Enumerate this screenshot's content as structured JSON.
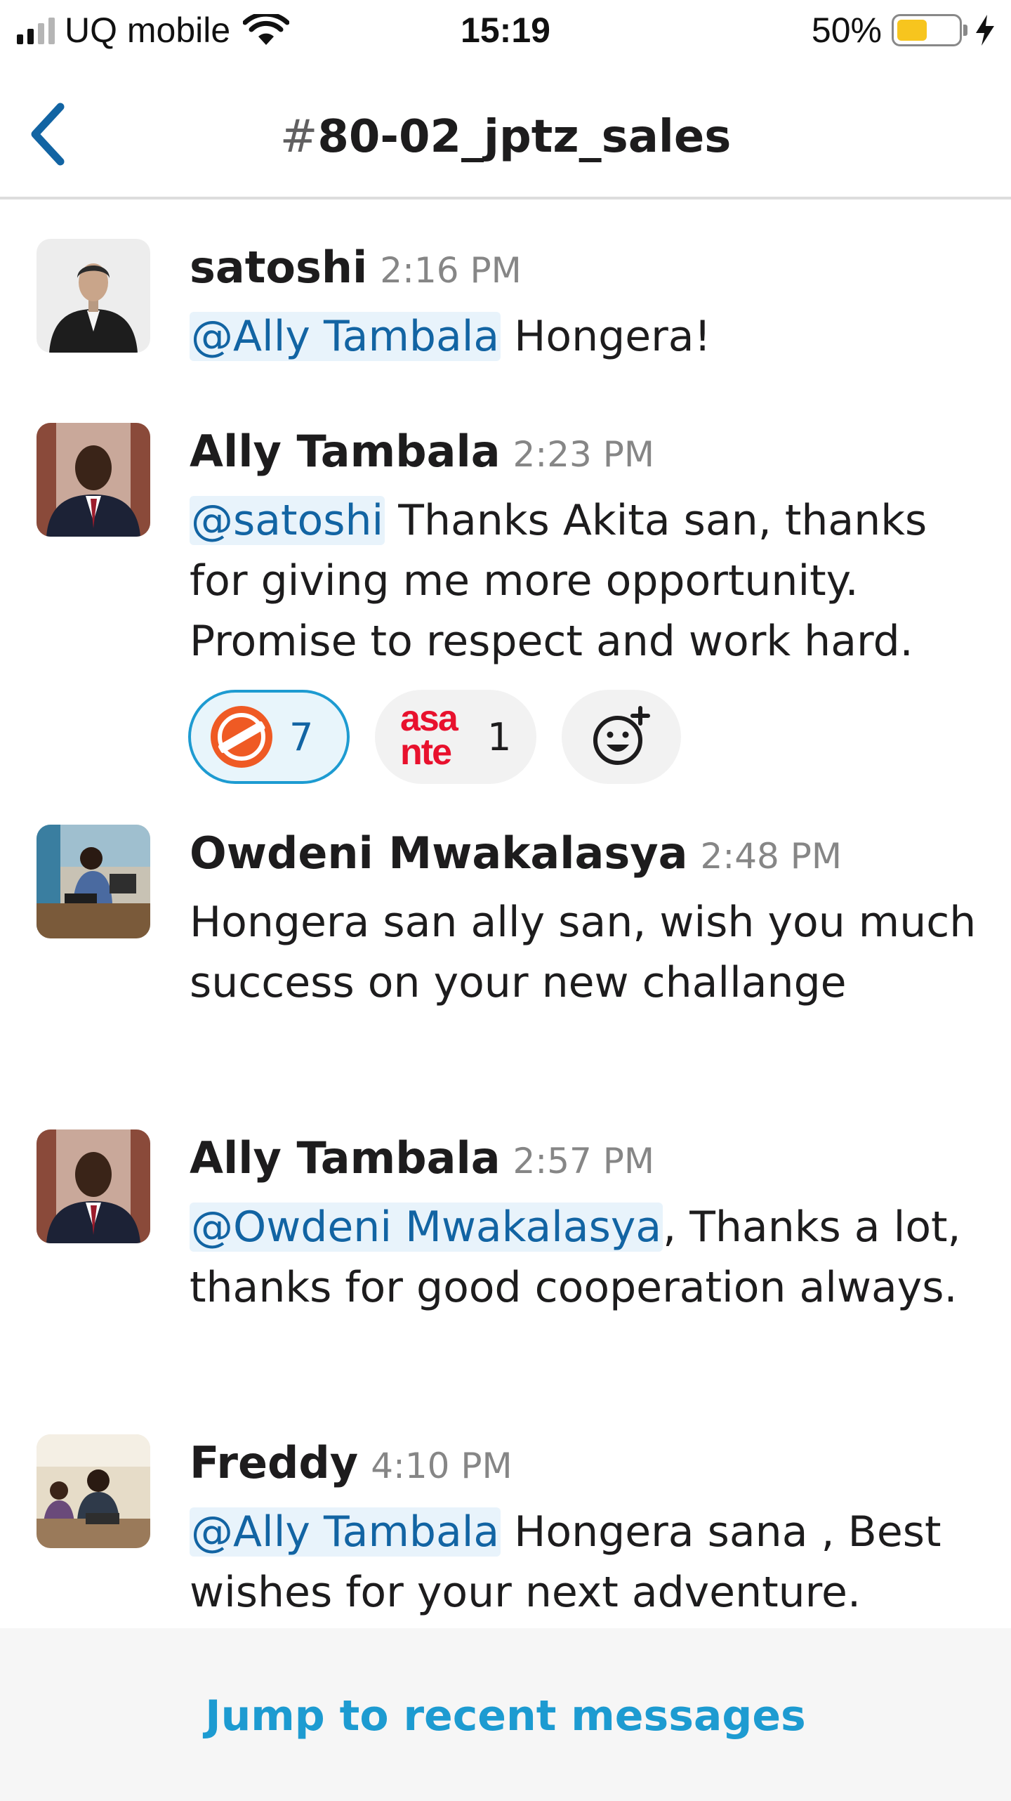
{
  "status_bar": {
    "carrier": "UQ mobile",
    "time": "15:19",
    "battery_percent": "50%",
    "battery_level": 0.5,
    "battery_color": "#f7c51e",
    "signal_bars": 2,
    "icons": [
      "signal-icon",
      "wifi-icon",
      "battery-icon",
      "charging-bolt-icon"
    ]
  },
  "header": {
    "hash": "#",
    "channel_name": "80-02_jptz_sales",
    "back_icon": "chevron-left-icon"
  },
  "messages": [
    {
      "author": "satoshi",
      "time": "2:16 PM",
      "mention": "@Ally Tambala",
      "text": " Hongera!"
    },
    {
      "author": "Ally Tambala",
      "time": "2:23 PM",
      "mention": "@satoshi",
      "text": " Thanks Akita san, thanks for giving me more opportunity. Promise to respect and work hard.",
      "reactions": [
        {
          "icon": "custom-emoji-icon",
          "count": "7",
          "selected": true
        },
        {
          "icon": "asante-emoji-icon",
          "label_top": "asa",
          "label_bottom": "nte",
          "count": "1",
          "selected": false
        },
        {
          "icon": "add-reaction-icon"
        }
      ]
    },
    {
      "author": "Owdeni Mwakalasya",
      "time": "2:48 PM",
      "text": "Hongera san ally san, wish you much success on your new challange"
    },
    {
      "author": "Ally Tambala",
      "time": "2:57 PM",
      "mention": "@Owdeni Mwakalasya",
      "text": ", Thanks a lot, thanks for good cooperation always."
    },
    {
      "author": "Freddy",
      "time": "4:10 PM",
      "mention": "@Ally Tambala",
      "text": " Hongera sana , Best wishes for your next adventure."
    }
  ],
  "footer": {
    "jump_label": "Jump to recent messages"
  },
  "colors": {
    "mention_text": "#1264a3",
    "mention_bg": "#e8f3fb",
    "accent": "#1d9bd1",
    "timestamp": "#868686"
  }
}
